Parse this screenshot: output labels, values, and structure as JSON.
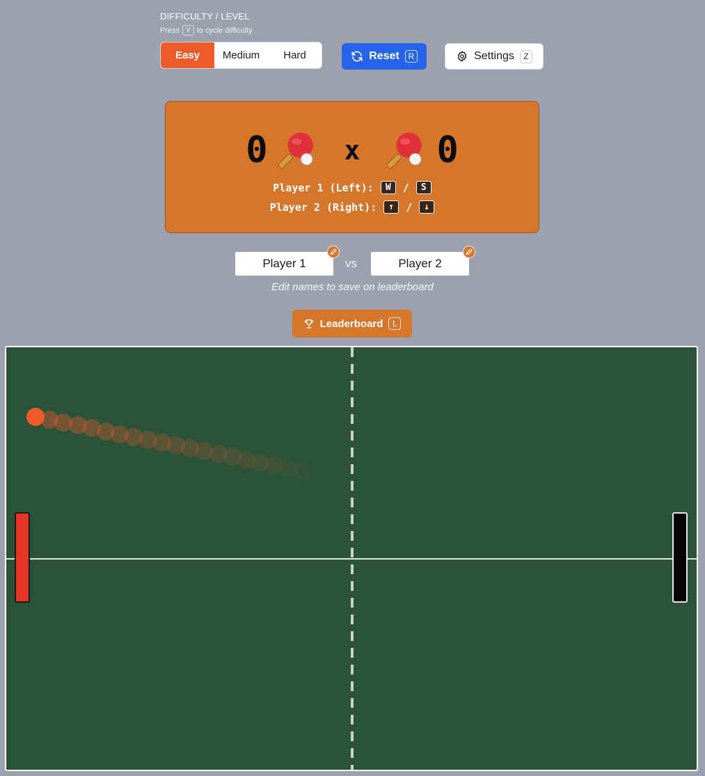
{
  "difficulty": {
    "title": "DIFFICULTY / LEVEL",
    "hint_press": "Press",
    "hint_key": "V",
    "hint_rest": "to cycle difficulty",
    "options": [
      "Easy",
      "Medium",
      "Hard"
    ],
    "selected": "Easy"
  },
  "toolbar": {
    "reset_label": "Reset",
    "reset_key": "R",
    "reset_icon": "refresh-icon",
    "settings_label": "Settings",
    "settings_key": "Z",
    "settings_icon": "gear-icon"
  },
  "score": {
    "left": "0",
    "separator": "x",
    "right": "0",
    "icon": "ping-pong-paddle-icon",
    "p1_controls_label": "Player 1 (Left):",
    "p1_key_up": "W",
    "p1_key_down": "S",
    "p2_controls_label": "Player 2 (Right):",
    "p2_key_up": "↑",
    "p2_key_down": "↓",
    "key_separator": "/"
  },
  "players": {
    "player1_name": "Player 1",
    "player2_name": "Player 2",
    "vs": "vs",
    "hint": "Edit names to save on leaderboard",
    "edit_icon": "pencil-icon"
  },
  "leaderboard": {
    "label": "Leaderboard",
    "key": "L",
    "icon": "trophy-icon"
  },
  "colors": {
    "accent_orange": "#d5762b",
    "active_segment": "#ee5b2b",
    "reset_blue": "#2563eb",
    "table_green": "#2a533a",
    "ball": "#ee5b2b",
    "left_paddle": "#e83526",
    "right_paddle": "#050505"
  }
}
